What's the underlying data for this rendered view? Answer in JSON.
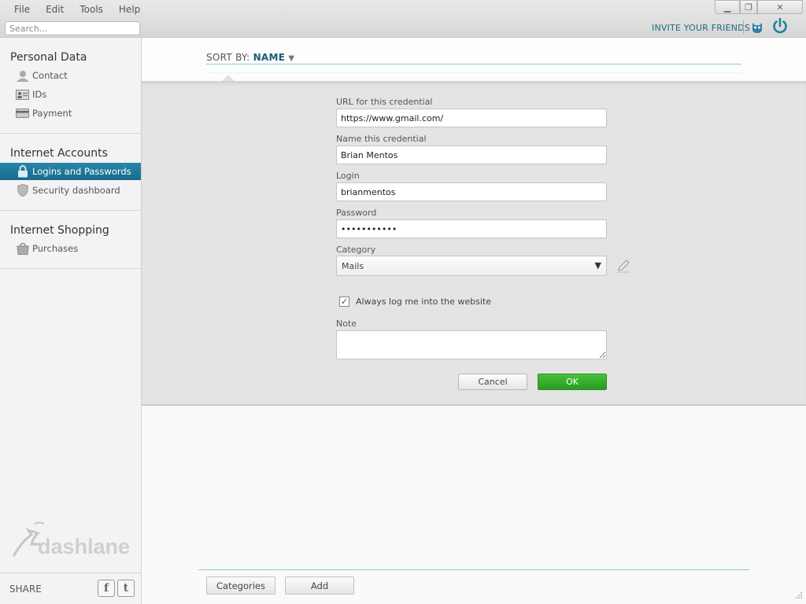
{
  "menu": {
    "items": [
      "File",
      "Edit",
      "Tools",
      "Help"
    ]
  },
  "search": {
    "placeholder": "Search..."
  },
  "header": {
    "invite": "INVITE YOUR FRIENDS"
  },
  "sidebar": {
    "sections": [
      {
        "title": "Personal Data",
        "items": [
          {
            "label": "Contact",
            "icon": "contact-icon"
          },
          {
            "label": "IDs",
            "icon": "id-card-icon"
          },
          {
            "label": "Payment",
            "icon": "credit-card-icon"
          }
        ]
      },
      {
        "title": "Internet Accounts",
        "items": [
          {
            "label": "Logins and Passwords",
            "icon": "lock-icon",
            "active": true
          },
          {
            "label": "Security dashboard",
            "icon": "shield-icon"
          }
        ]
      },
      {
        "title": "Internet Shopping",
        "items": [
          {
            "label": "Purchases",
            "icon": "shopping-bag-icon"
          }
        ]
      }
    ],
    "logo": "dashlane",
    "share": "SHARE",
    "social": [
      "f",
      "t"
    ]
  },
  "sort": {
    "label": "SORT BY:",
    "value": "NAME"
  },
  "form": {
    "url_label": "URL for this credential",
    "url_value": "https://www.gmail.com/",
    "name_label": "Name this credential",
    "name_value": "Brian Mentos",
    "login_label": "Login",
    "login_value": "brianmentos",
    "password_label": "Password",
    "password_value": "•••••••••••",
    "category_label": "Category",
    "category_value": "Mails",
    "autologin_label": "Always log me into the website",
    "autologin_checked": true,
    "note_label": "Note",
    "note_value": "",
    "cancel": "Cancel",
    "ok": "OK"
  },
  "footer": {
    "categories": "Categories",
    "add": "Add"
  },
  "colors": {
    "accent": "#1f6a86",
    "active_item": "#1a7698",
    "ok_button": "#34ad2b"
  }
}
